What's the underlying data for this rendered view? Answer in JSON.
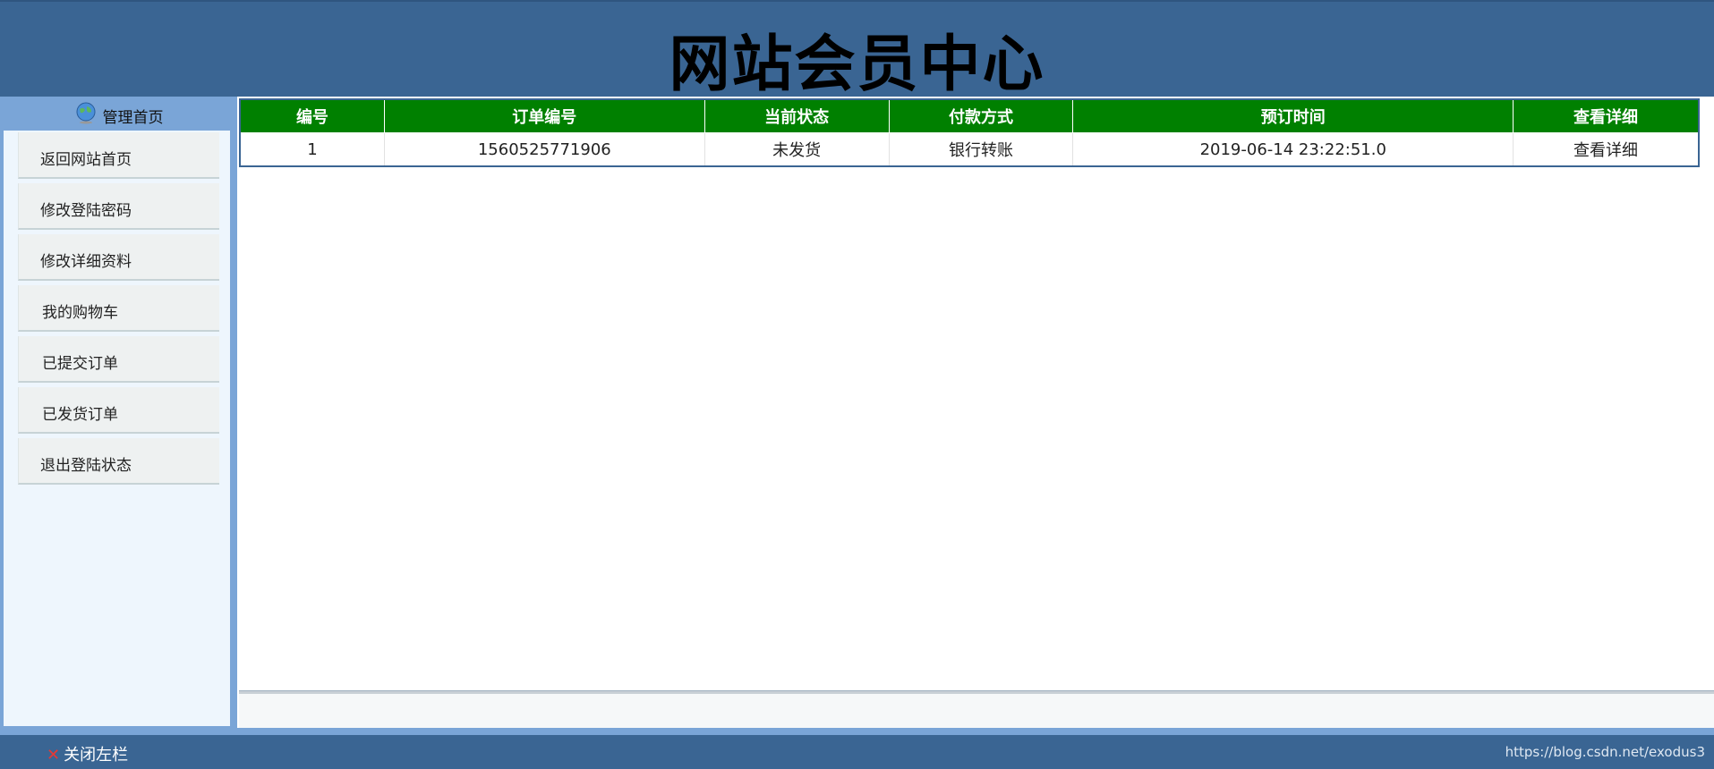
{
  "header": {
    "title": "网站会员中心"
  },
  "sidebar": {
    "head_label": "管理首页",
    "items": [
      {
        "label": "返回网站首页"
      },
      {
        "label": "修改登陆密码"
      },
      {
        "label": "修改详细资料"
      },
      {
        "label": "我的购物车"
      },
      {
        "label": "已提交订单"
      },
      {
        "label": "已发货订单"
      },
      {
        "label": "退出登陆状态"
      }
    ]
  },
  "table": {
    "headers": [
      "编号",
      "订单编号",
      "当前状态",
      "付款方式",
      "预订时间",
      "查看详细"
    ],
    "rows": [
      [
        "1",
        "1560525771906",
        "未发货",
        "银行转账",
        "2019-06-14 23:22:51.0",
        "查看详细"
      ]
    ]
  },
  "footer": {
    "close_label": "关闭左栏",
    "credit": "https://blog.csdn.net/exodus3"
  },
  "colors": {
    "header_bg": "#3a6593",
    "sidebar_bg": "#7aa5d7",
    "table_header_bg": "#008000"
  },
  "icons": {
    "sidebar_head": "globe-icon",
    "close": "close-icon"
  }
}
